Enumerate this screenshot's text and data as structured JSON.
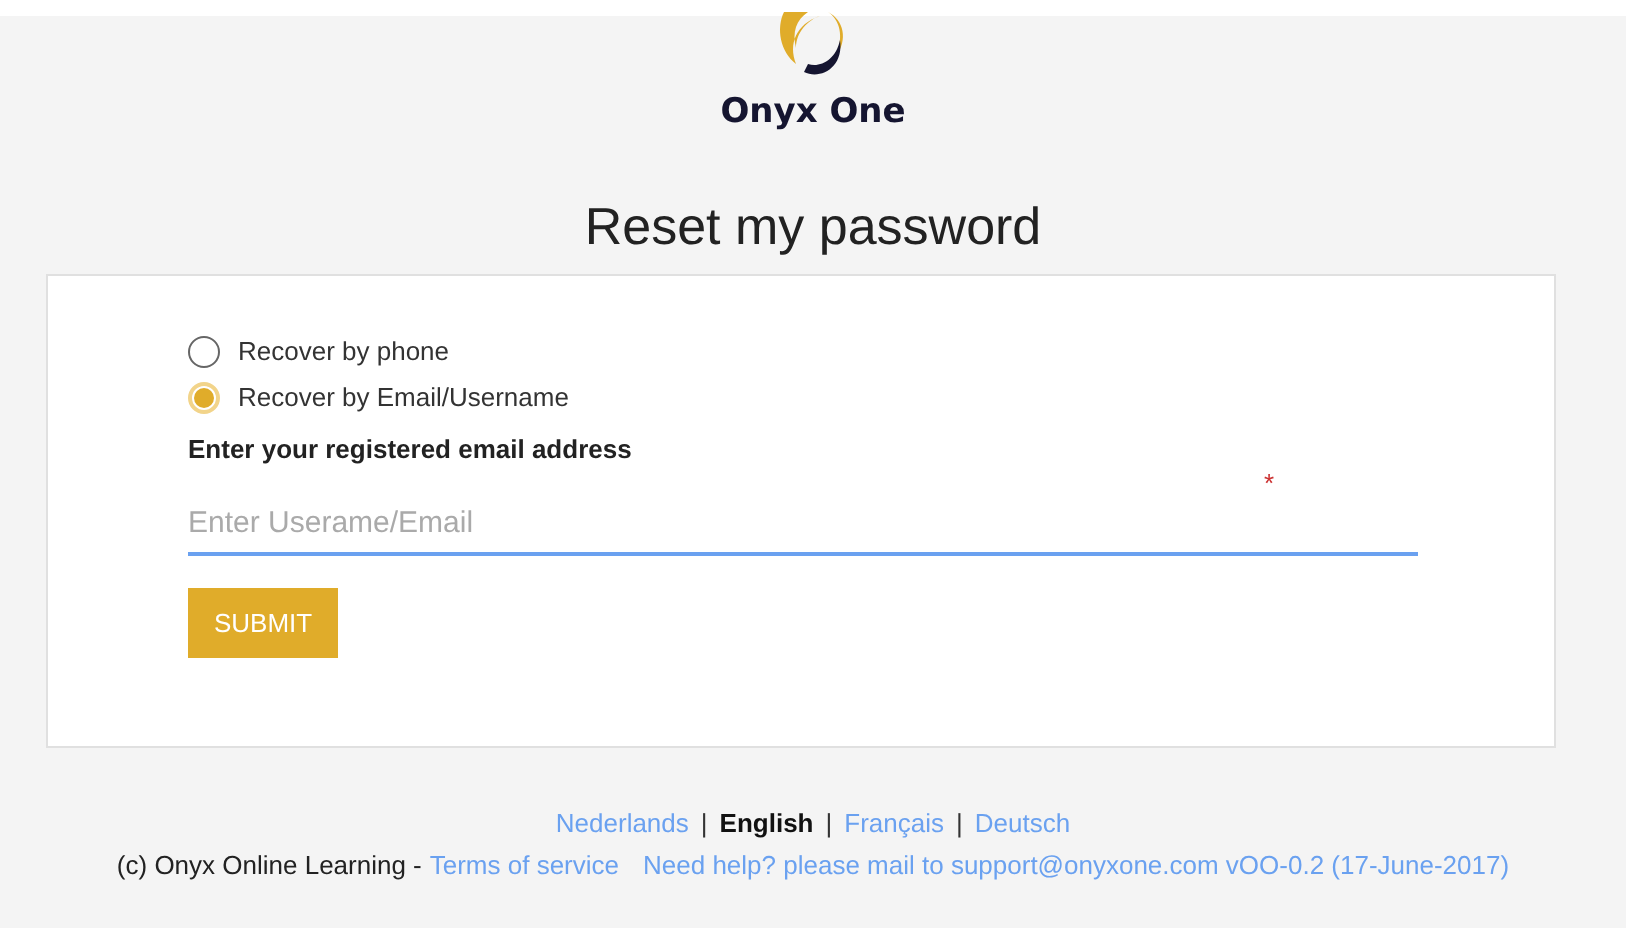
{
  "brand": {
    "name": "Onyx One"
  },
  "title": "Reset my password",
  "form": {
    "options": [
      {
        "label": "Recover by phone",
        "selected": false
      },
      {
        "label": "Recover by Email/Username",
        "selected": true
      }
    ],
    "field_label": "Enter your registered email address",
    "required_mark": "*",
    "placeholder": "Enter Userame/Email",
    "submit": "SUBMIT"
  },
  "footer": {
    "languages": [
      {
        "label": "Nederlands",
        "selected": false
      },
      {
        "label": "English",
        "selected": true
      },
      {
        "label": "Français",
        "selected": false
      },
      {
        "label": "Deutsch",
        "selected": false
      }
    ],
    "separators": [
      "|",
      "|",
      "|"
    ],
    "copyright": "(c) Onyx Online Learning -",
    "terms_link": "Terms of service",
    "help_link": "Need help? please mail to support@onyxone.com vOO-0.2 (17-June-2017)"
  }
}
